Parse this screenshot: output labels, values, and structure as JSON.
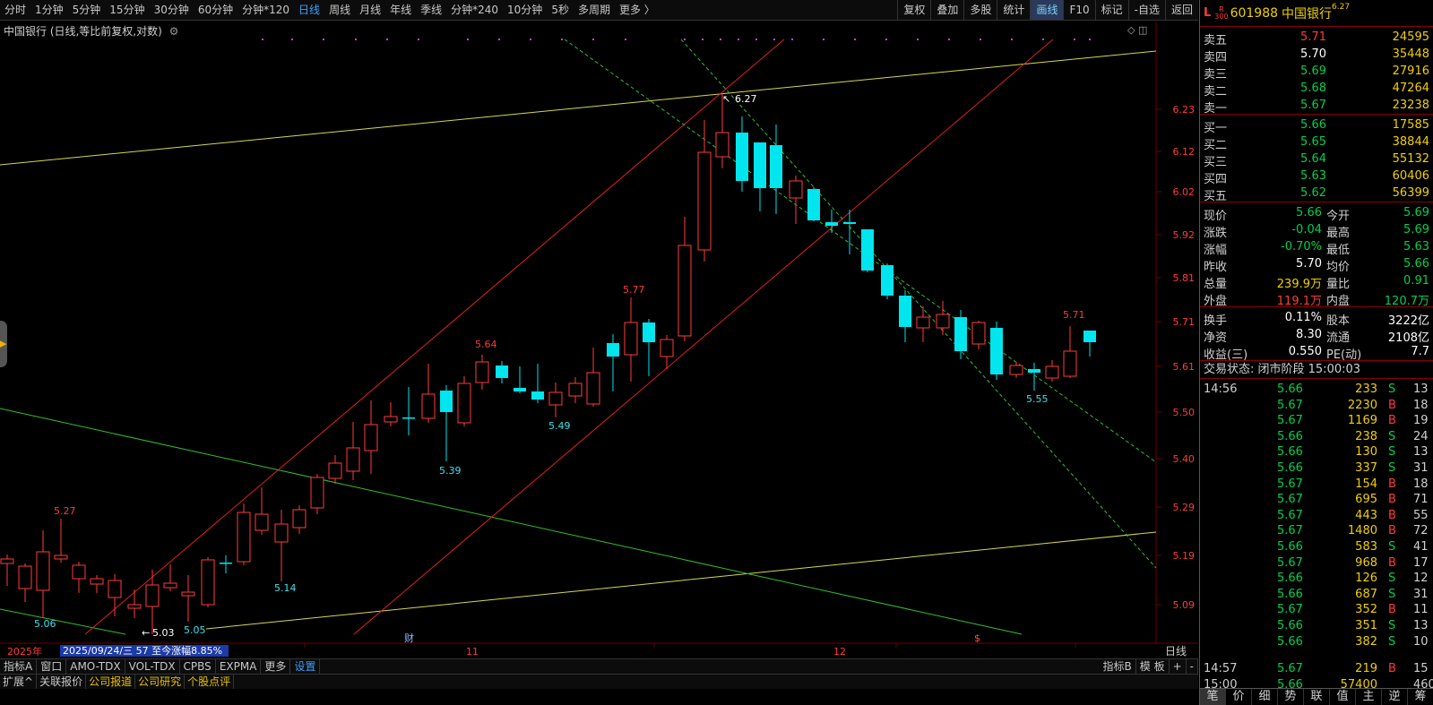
{
  "toolbar": {
    "tabs": [
      "分时",
      "1分钟",
      "5分钟",
      "15分钟",
      "30分钟",
      "60分钟",
      "分钟*120",
      "日线",
      "周线",
      "月线",
      "年线",
      "季线",
      "分钟*240",
      "10分钟",
      "5秒",
      "多周期",
      "更多 〉"
    ],
    "active": "日线",
    "right": [
      "复权",
      "叠加",
      "多股",
      "统计",
      "画线",
      "F10",
      "标记",
      "-自选",
      "返回"
    ],
    "right_active": "画线"
  },
  "chart": {
    "title": "中国银行 (日线,等比前复权,对数)",
    "y_ticks": [
      "6.23",
      "6.12",
      "6.02",
      "5.92",
      "5.81",
      "5.71",
      "5.61",
      "5.50",
      "5.40",
      "5.29",
      "5.19",
      "5.09"
    ],
    "x_labels": [
      "2025年",
      "11",
      "12"
    ],
    "period_label": "日线",
    "date_info": "2025/09/24/三 57 至今涨幅8.85%",
    "price_labels": [
      {
        "text": "5.27",
        "color": "red"
      },
      {
        "text": "5.06",
        "color": "cyan"
      },
      {
        "text": "5.03",
        "color": "white"
      },
      {
        "text": "5.05",
        "color": "cyan"
      },
      {
        "text": "5.14",
        "color": "cyan"
      },
      {
        "text": "5.39",
        "color": "cyan"
      },
      {
        "text": "5.64",
        "color": "red"
      },
      {
        "text": "5.49",
        "color": "cyan"
      },
      {
        "text": "5.77",
        "color": "red"
      },
      {
        "text": "6.27",
        "color": "white"
      },
      {
        "text": "5.55",
        "color": "cyan"
      },
      {
        "text": "5.71",
        "color": "red"
      }
    ],
    "markers": [
      "财",
      "$"
    ]
  },
  "indicator_bar": {
    "items": [
      "指标A",
      "窗口",
      "AMO-TDX",
      "VOL-TDX",
      "CPBS",
      "EXPMA",
      "更多",
      "设置"
    ],
    "highlight": "设置",
    "right": [
      "指标B",
      "模 板",
      "+",
      "-"
    ]
  },
  "ext_bar": {
    "items": [
      "扩展^",
      "关联报价",
      "公司报道",
      "公司研究",
      "个股点评"
    ]
  },
  "panel": {
    "code": "601988",
    "name": "中国银行",
    "name_sup": "6.27",
    "badge_L": "L",
    "badge_R300": [
      "R",
      "300"
    ],
    "asks": [
      {
        "label": "卖五",
        "price": "5.71",
        "vol": "24595",
        "color": "red"
      },
      {
        "label": "卖四",
        "price": "5.70",
        "vol": "35448",
        "color": "white"
      },
      {
        "label": "卖三",
        "price": "5.69",
        "vol": "27916",
        "color": "green"
      },
      {
        "label": "卖二",
        "price": "5.68",
        "vol": "47264",
        "color": "green"
      },
      {
        "label": "卖一",
        "price": "5.67",
        "vol": "23238",
        "color": "green"
      }
    ],
    "bids": [
      {
        "label": "买一",
        "price": "5.66",
        "vol": "17585",
        "color": "green"
      },
      {
        "label": "买二",
        "price": "5.65",
        "vol": "38844",
        "color": "green"
      },
      {
        "label": "买三",
        "price": "5.64",
        "vol": "55132",
        "color": "green"
      },
      {
        "label": "买四",
        "price": "5.63",
        "vol": "60406",
        "color": "green"
      },
      {
        "label": "买五",
        "price": "5.62",
        "vol": "56399",
        "color": "green"
      }
    ],
    "quotes": [
      {
        "l1": "现价",
        "v1": "5.66",
        "c1": "green",
        "l2": "今开",
        "v2": "5.69",
        "c2": "green"
      },
      {
        "l1": "涨跌",
        "v1": "-0.04",
        "c1": "green",
        "l2": "最高",
        "v2": "5.69",
        "c2": "green"
      },
      {
        "l1": "涨幅",
        "v1": "-0.70%",
        "c1": "green",
        "l2": "最低",
        "v2": "5.63",
        "c2": "green"
      },
      {
        "l1": "昨收",
        "v1": "5.70",
        "c1": "white",
        "l2": "均价",
        "v2": "5.66",
        "c2": "green"
      },
      {
        "l1": "总量",
        "v1": "239.9万",
        "c1": "yellow",
        "l2": "量比",
        "v2": "0.91",
        "c2": "green"
      },
      {
        "l1": "外盘",
        "v1": "119.1万",
        "c1": "red",
        "l2": "内盘",
        "v2": "120.7万",
        "c2": "green"
      }
    ],
    "quotes2": [
      {
        "l1": "换手",
        "v1": "0.11%",
        "c1": "white",
        "l2": "股本",
        "v2": "3222亿",
        "c2": "white"
      },
      {
        "l1": "净资",
        "v1": "8.30",
        "c1": "white",
        "l2": "流通",
        "v2": "2108亿",
        "c2": "white"
      },
      {
        "l1": "收益(三)",
        "v1": "0.550",
        "c1": "white",
        "l2": "PE(动)",
        "v2": "7.7",
        "c2": "white"
      }
    ],
    "status": "交易状态: 闭市阶段 15:00:03",
    "ticks": [
      {
        "t": "14:56",
        "p": "5.66",
        "v": "233",
        "bs": "S",
        "n": "13"
      },
      {
        "t": "",
        "p": "5.67",
        "v": "2230",
        "bs": "B",
        "n": "18"
      },
      {
        "t": "",
        "p": "5.67",
        "v": "1169",
        "bs": "B",
        "n": "19"
      },
      {
        "t": "",
        "p": "5.66",
        "v": "238",
        "bs": "S",
        "n": "24"
      },
      {
        "t": "",
        "p": "5.66",
        "v": "130",
        "bs": "S",
        "n": "13"
      },
      {
        "t": "",
        "p": "5.66",
        "v": "337",
        "bs": "S",
        "n": "31"
      },
      {
        "t": "",
        "p": "5.67",
        "v": "154",
        "bs": "B",
        "n": "18"
      },
      {
        "t": "",
        "p": "5.67",
        "v": "695",
        "bs": "B",
        "n": "71"
      },
      {
        "t": "",
        "p": "5.67",
        "v": "443",
        "bs": "B",
        "n": "55"
      },
      {
        "t": "",
        "p": "5.67",
        "v": "1480",
        "bs": "B",
        "n": "72"
      },
      {
        "t": "",
        "p": "5.66",
        "v": "583",
        "bs": "S",
        "n": "41"
      },
      {
        "t": "",
        "p": "5.67",
        "v": "968",
        "bs": "B",
        "n": "17"
      },
      {
        "t": "",
        "p": "5.66",
        "v": "126",
        "bs": "S",
        "n": "12"
      },
      {
        "t": "",
        "p": "5.66",
        "v": "687",
        "bs": "S",
        "n": "31"
      },
      {
        "t": "",
        "p": "5.67",
        "v": "352",
        "bs": "B",
        "n": "11"
      },
      {
        "t": "",
        "p": "5.66",
        "v": "351",
        "bs": "S",
        "n": "13"
      },
      {
        "t": "",
        "p": "5.66",
        "v": "382",
        "bs": "S",
        "n": "10"
      },
      {
        "t": "14:57",
        "p": "5.67",
        "v": "219",
        "bs": "B",
        "n": "15"
      },
      {
        "t": "15:00",
        "p": "5.66",
        "v": "57400",
        "bs": "",
        "n": "460"
      }
    ],
    "bottom_tabs": [
      "笔",
      "价",
      "细",
      "势",
      "联",
      "值",
      "主",
      "逆",
      "筹"
    ],
    "bottom_active": "笔"
  },
  "colors": {
    "up": "#ff3b3b",
    "down": "#00e5ee",
    "grid": "#6b0000",
    "ma_yellow": "#d8d84a",
    "ma_green": "#2fbf2f"
  }
}
